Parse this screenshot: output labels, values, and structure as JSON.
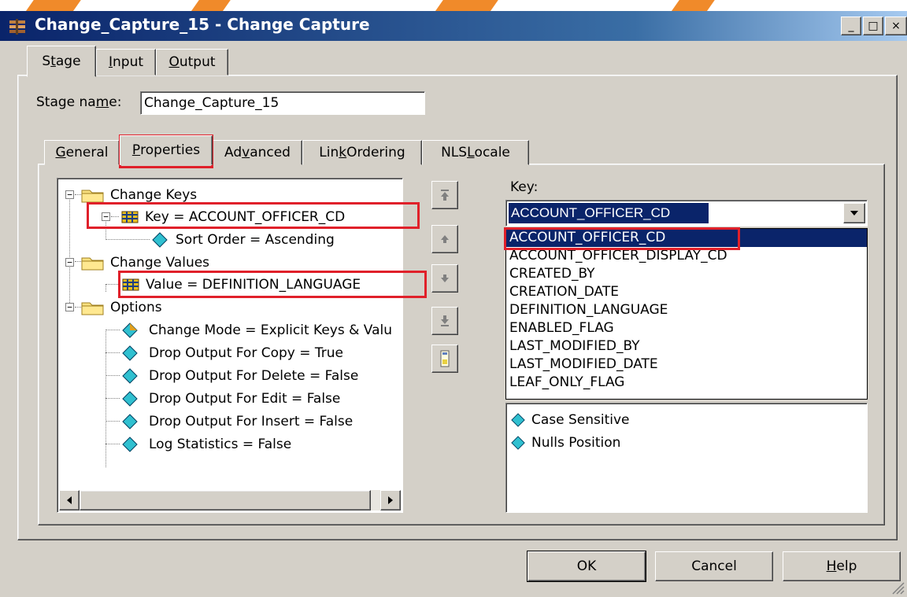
{
  "window": {
    "title": "Change_Capture_15 - Change Capture",
    "min_glyph": "_",
    "max_glyph": "□",
    "close_glyph": "×"
  },
  "main_tabs": [
    {
      "pre": "S",
      "ul": "t",
      "post": "age"
    },
    {
      "pre": "",
      "ul": "I",
      "post": "nput"
    },
    {
      "pre": "",
      "ul": "O",
      "post": "utput"
    }
  ],
  "stage_name": {
    "label_pre": "Stage na",
    "label_ul": "m",
    "label_post": "e:",
    "value": "Change_Capture_15"
  },
  "sub_tabs": [
    {
      "pre": "",
      "ul": "G",
      "post": "eneral"
    },
    {
      "pre": "",
      "ul": "P",
      "post": "roperties"
    },
    {
      "pre": "Ad",
      "ul": "v",
      "post": "anced"
    },
    {
      "pre": "Lin",
      "ul": "k",
      "post": " Ordering"
    },
    {
      "pre": "NLS ",
      "ul": "L",
      "post": "ocale"
    }
  ],
  "tree": {
    "change_keys": "Change Keys",
    "key": "Key = ACCOUNT_OFFICER_CD",
    "sort_order": "Sort Order = Ascending",
    "change_values": "Change Values",
    "value": "Value = DEFINITION_LANGUAGE",
    "options": "Options",
    "change_mode": "Change Mode = Explicit Keys & Valu",
    "drop_copy": "Drop Output For Copy = True",
    "drop_delete": "Drop Output For Delete = False",
    "drop_edit": "Drop Output For Edit = False",
    "drop_insert": "Drop Output For Insert = False",
    "log_stats": "Log Statistics = False"
  },
  "key_panel": {
    "label": "Key:",
    "selected": "ACCOUNT_OFFICER_CD",
    "options": [
      "ACCOUNT_OFFICER_CD",
      "ACCOUNT_OFFICER_DISPLAY_CD",
      "CREATED_BY",
      "CREATION_DATE",
      "DEFINITION_LANGUAGE",
      "ENABLED_FLAG",
      "LAST_MODIFIED_BY",
      "LAST_MODIFIED_DATE",
      "LEAF_ONLY_FLAG"
    ],
    "sub_properties": [
      "Case Sensitive",
      "Nulls Position"
    ]
  },
  "buttons": {
    "ok": "OK",
    "cancel": "Cancel",
    "help_ul": "H",
    "help_post": "elp"
  },
  "colors": {
    "highlight_red": "#e0202a",
    "selection_blue": "#0a246a",
    "titlebar_start": "#0a246a",
    "face": "#d4d0c8"
  }
}
